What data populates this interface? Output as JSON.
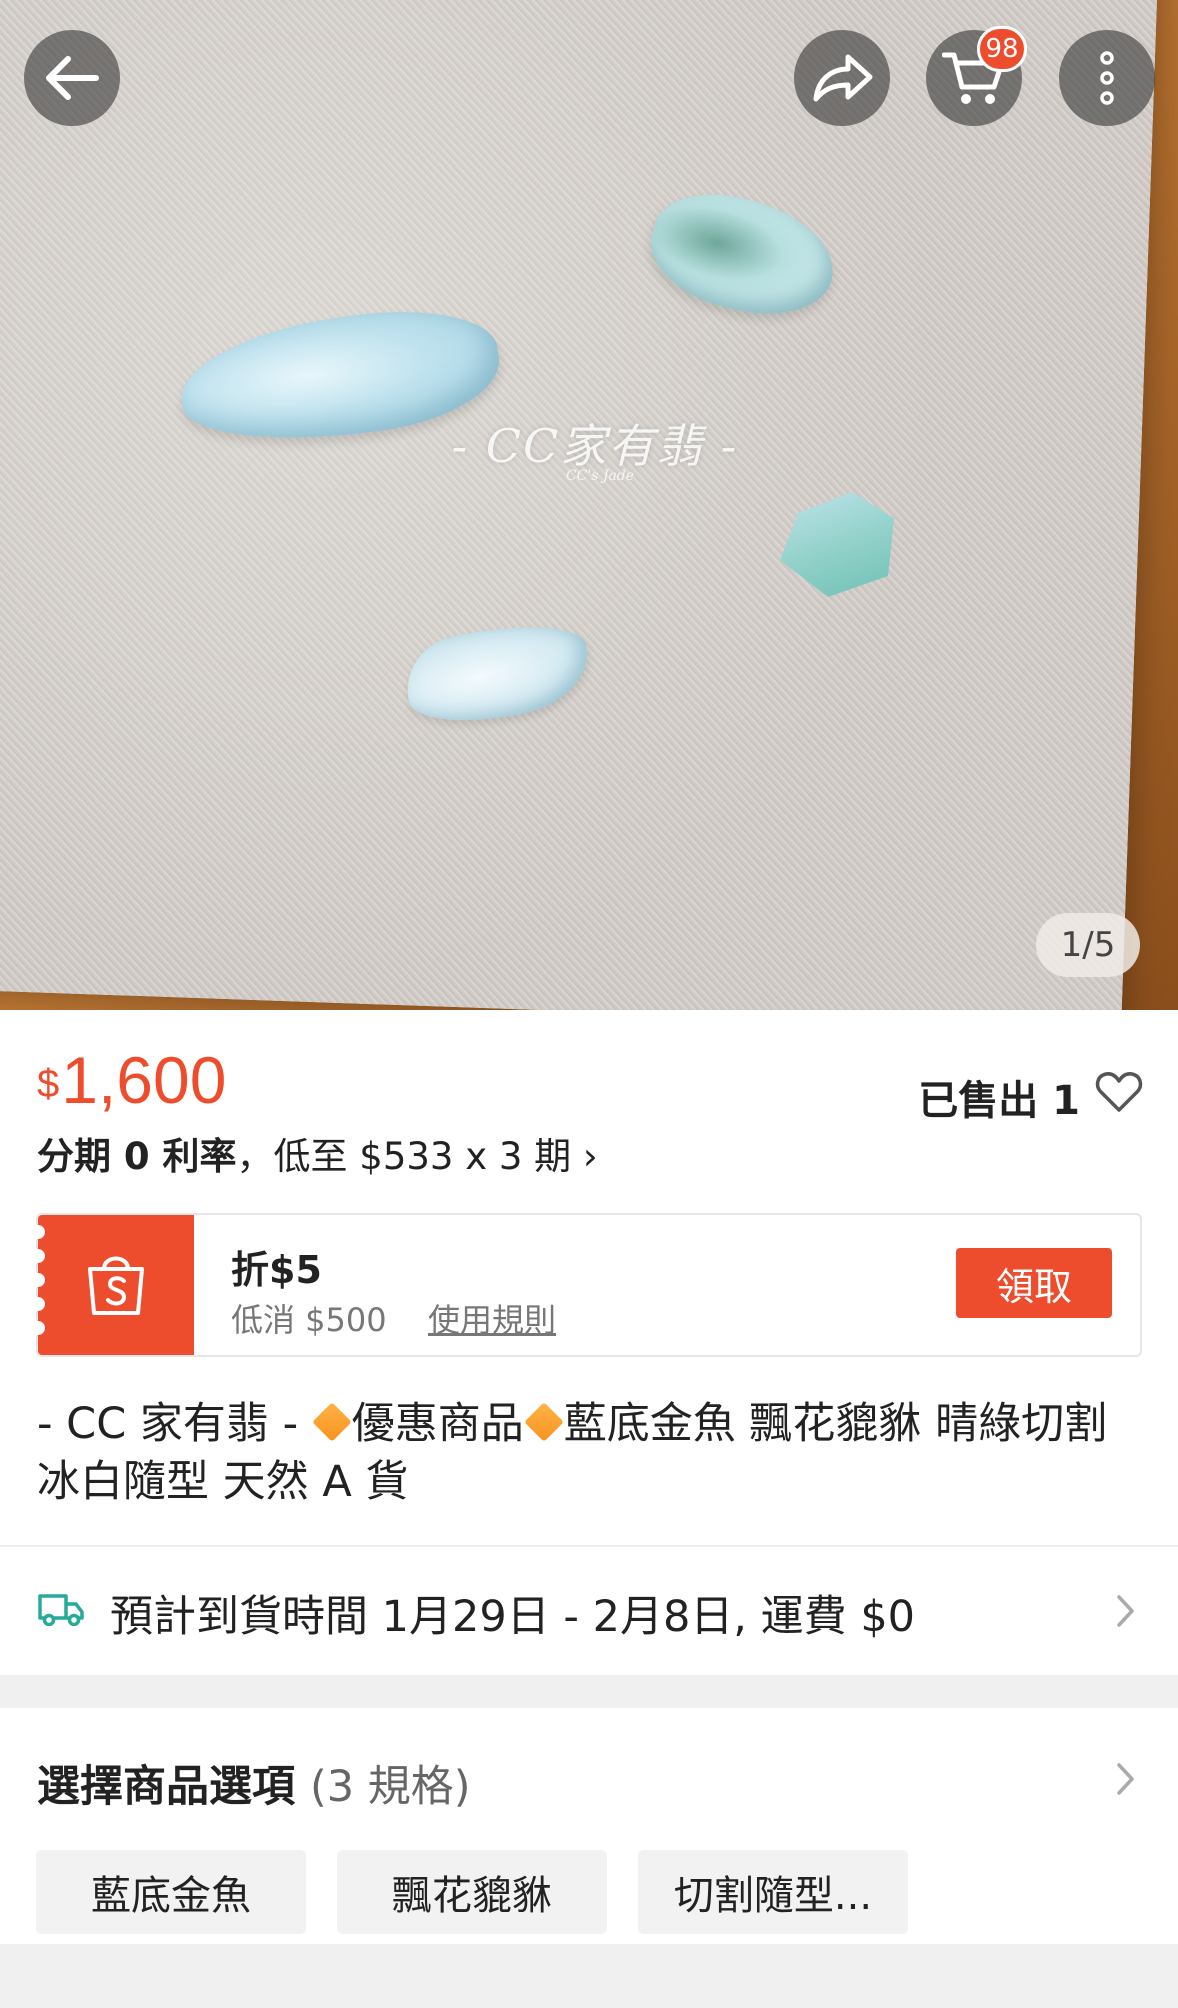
{
  "header": {
    "cart_badge": "98",
    "icons": [
      "back-arrow-icon",
      "share-icon",
      "cart-icon",
      "more-vertical-icon"
    ]
  },
  "gallery": {
    "indicator": "1/5",
    "watermark": "- CC家有翡 -",
    "watermark_sub": "CC's Jade"
  },
  "product": {
    "currency": "$",
    "price": "1,600",
    "sold": "已售出 1",
    "installment_bold": "分期 0 利率",
    "installment_rest": "，低至 $533 x 3 期 ›",
    "title_part1": "- CC 家有翡 -",
    "title_part2": "優惠商品",
    "title_part3": "藍底金魚 飄花貔貅 晴綠切割 冰白隨型 天然 A 貨"
  },
  "voucher": {
    "title": "折$5",
    "min_spend": "低消 $500",
    "rule_link": "使用規則",
    "claim_label": "領取"
  },
  "shipping": {
    "text": "預計到貨時間 1月29日 - 2月8日, 運費 $0"
  },
  "options": {
    "title": "選擇商品選項",
    "count": "(3 規格)",
    "chips": [
      "藍底金魚",
      "飄花貔貅",
      "切割隨型..."
    ]
  },
  "colors": {
    "brand": "#ee4d2d",
    "shipping_icon": "#26aa99"
  }
}
